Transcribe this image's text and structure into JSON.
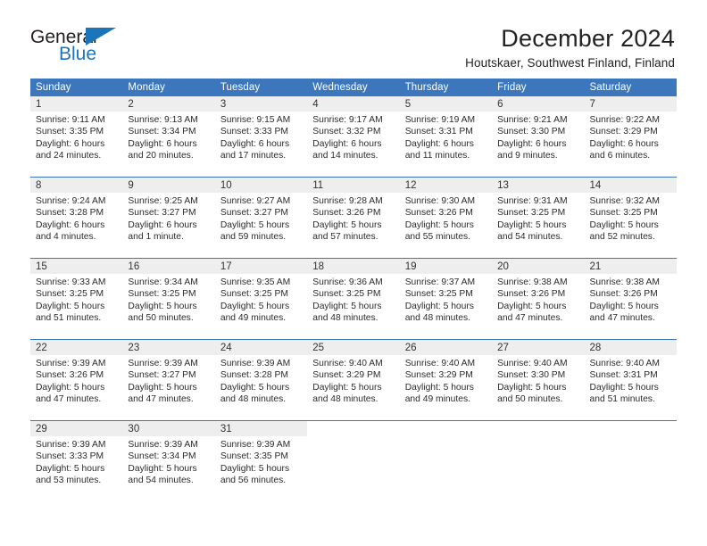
{
  "logo": {
    "word_general": "General",
    "word_blue": "Blue",
    "mark": "triangle-flag",
    "color_blue": "#1b75bb",
    "color_dark": "#231f20"
  },
  "header": {
    "title": "December 2024",
    "subtitle": "Houtskaer, Southwest Finland, Finland"
  },
  "theme": {
    "header_blue": "#3c77bd",
    "daynum_band": "#eeeeee",
    "text": "#2b2b2b"
  },
  "calendar": {
    "weekday_headers": [
      "Sunday",
      "Monday",
      "Tuesday",
      "Wednesday",
      "Thursday",
      "Friday",
      "Saturday"
    ],
    "weeks": [
      [
        {
          "day": "1",
          "sunrise": "Sunrise: 9:11 AM",
          "sunset": "Sunset: 3:35 PM",
          "daylight_line1": "Daylight: 6 hours",
          "daylight_line2": "and 24 minutes."
        },
        {
          "day": "2",
          "sunrise": "Sunrise: 9:13 AM",
          "sunset": "Sunset: 3:34 PM",
          "daylight_line1": "Daylight: 6 hours",
          "daylight_line2": "and 20 minutes."
        },
        {
          "day": "3",
          "sunrise": "Sunrise: 9:15 AM",
          "sunset": "Sunset: 3:33 PM",
          "daylight_line1": "Daylight: 6 hours",
          "daylight_line2": "and 17 minutes."
        },
        {
          "day": "4",
          "sunrise": "Sunrise: 9:17 AM",
          "sunset": "Sunset: 3:32 PM",
          "daylight_line1": "Daylight: 6 hours",
          "daylight_line2": "and 14 minutes."
        },
        {
          "day": "5",
          "sunrise": "Sunrise: 9:19 AM",
          "sunset": "Sunset: 3:31 PM",
          "daylight_line1": "Daylight: 6 hours",
          "daylight_line2": "and 11 minutes."
        },
        {
          "day": "6",
          "sunrise": "Sunrise: 9:21 AM",
          "sunset": "Sunset: 3:30 PM",
          "daylight_line1": "Daylight: 6 hours",
          "daylight_line2": "and 9 minutes."
        },
        {
          "day": "7",
          "sunrise": "Sunrise: 9:22 AM",
          "sunset": "Sunset: 3:29 PM",
          "daylight_line1": "Daylight: 6 hours",
          "daylight_line2": "and 6 minutes."
        }
      ],
      [
        {
          "day": "8",
          "sunrise": "Sunrise: 9:24 AM",
          "sunset": "Sunset: 3:28 PM",
          "daylight_line1": "Daylight: 6 hours",
          "daylight_line2": "and 4 minutes."
        },
        {
          "day": "9",
          "sunrise": "Sunrise: 9:25 AM",
          "sunset": "Sunset: 3:27 PM",
          "daylight_line1": "Daylight: 6 hours",
          "daylight_line2": "and 1 minute."
        },
        {
          "day": "10",
          "sunrise": "Sunrise: 9:27 AM",
          "sunset": "Sunset: 3:27 PM",
          "daylight_line1": "Daylight: 5 hours",
          "daylight_line2": "and 59 minutes."
        },
        {
          "day": "11",
          "sunrise": "Sunrise: 9:28 AM",
          "sunset": "Sunset: 3:26 PM",
          "daylight_line1": "Daylight: 5 hours",
          "daylight_line2": "and 57 minutes."
        },
        {
          "day": "12",
          "sunrise": "Sunrise: 9:30 AM",
          "sunset": "Sunset: 3:26 PM",
          "daylight_line1": "Daylight: 5 hours",
          "daylight_line2": "and 55 minutes."
        },
        {
          "day": "13",
          "sunrise": "Sunrise: 9:31 AM",
          "sunset": "Sunset: 3:25 PM",
          "daylight_line1": "Daylight: 5 hours",
          "daylight_line2": "and 54 minutes."
        },
        {
          "day": "14",
          "sunrise": "Sunrise: 9:32 AM",
          "sunset": "Sunset: 3:25 PM",
          "daylight_line1": "Daylight: 5 hours",
          "daylight_line2": "and 52 minutes."
        }
      ],
      [
        {
          "day": "15",
          "sunrise": "Sunrise: 9:33 AM",
          "sunset": "Sunset: 3:25 PM",
          "daylight_line1": "Daylight: 5 hours",
          "daylight_line2": "and 51 minutes."
        },
        {
          "day": "16",
          "sunrise": "Sunrise: 9:34 AM",
          "sunset": "Sunset: 3:25 PM",
          "daylight_line1": "Daylight: 5 hours",
          "daylight_line2": "and 50 minutes."
        },
        {
          "day": "17",
          "sunrise": "Sunrise: 9:35 AM",
          "sunset": "Sunset: 3:25 PM",
          "daylight_line1": "Daylight: 5 hours",
          "daylight_line2": "and 49 minutes."
        },
        {
          "day": "18",
          "sunrise": "Sunrise: 9:36 AM",
          "sunset": "Sunset: 3:25 PM",
          "daylight_line1": "Daylight: 5 hours",
          "daylight_line2": "and 48 minutes."
        },
        {
          "day": "19",
          "sunrise": "Sunrise: 9:37 AM",
          "sunset": "Sunset: 3:25 PM",
          "daylight_line1": "Daylight: 5 hours",
          "daylight_line2": "and 48 minutes."
        },
        {
          "day": "20",
          "sunrise": "Sunrise: 9:38 AM",
          "sunset": "Sunset: 3:26 PM",
          "daylight_line1": "Daylight: 5 hours",
          "daylight_line2": "and 47 minutes."
        },
        {
          "day": "21",
          "sunrise": "Sunrise: 9:38 AM",
          "sunset": "Sunset: 3:26 PM",
          "daylight_line1": "Daylight: 5 hours",
          "daylight_line2": "and 47 minutes."
        }
      ],
      [
        {
          "day": "22",
          "sunrise": "Sunrise: 9:39 AM",
          "sunset": "Sunset: 3:26 PM",
          "daylight_line1": "Daylight: 5 hours",
          "daylight_line2": "and 47 minutes."
        },
        {
          "day": "23",
          "sunrise": "Sunrise: 9:39 AM",
          "sunset": "Sunset: 3:27 PM",
          "daylight_line1": "Daylight: 5 hours",
          "daylight_line2": "and 47 minutes."
        },
        {
          "day": "24",
          "sunrise": "Sunrise: 9:39 AM",
          "sunset": "Sunset: 3:28 PM",
          "daylight_line1": "Daylight: 5 hours",
          "daylight_line2": "and 48 minutes."
        },
        {
          "day": "25",
          "sunrise": "Sunrise: 9:40 AM",
          "sunset": "Sunset: 3:29 PM",
          "daylight_line1": "Daylight: 5 hours",
          "daylight_line2": "and 48 minutes."
        },
        {
          "day": "26",
          "sunrise": "Sunrise: 9:40 AM",
          "sunset": "Sunset: 3:29 PM",
          "daylight_line1": "Daylight: 5 hours",
          "daylight_line2": "and 49 minutes."
        },
        {
          "day": "27",
          "sunrise": "Sunrise: 9:40 AM",
          "sunset": "Sunset: 3:30 PM",
          "daylight_line1": "Daylight: 5 hours",
          "daylight_line2": "and 50 minutes."
        },
        {
          "day": "28",
          "sunrise": "Sunrise: 9:40 AM",
          "sunset": "Sunset: 3:31 PM",
          "daylight_line1": "Daylight: 5 hours",
          "daylight_line2": "and 51 minutes."
        }
      ],
      [
        {
          "day": "29",
          "sunrise": "Sunrise: 9:39 AM",
          "sunset": "Sunset: 3:33 PM",
          "daylight_line1": "Daylight: 5 hours",
          "daylight_line2": "and 53 minutes."
        },
        {
          "day": "30",
          "sunrise": "Sunrise: 9:39 AM",
          "sunset": "Sunset: 3:34 PM",
          "daylight_line1": "Daylight: 5 hours",
          "daylight_line2": "and 54 minutes."
        },
        {
          "day": "31",
          "sunrise": "Sunrise: 9:39 AM",
          "sunset": "Sunset: 3:35 PM",
          "daylight_line1": "Daylight: 5 hours",
          "daylight_line2": "and 56 minutes."
        },
        {
          "day": "",
          "sunrise": "",
          "sunset": "",
          "daylight_line1": "",
          "daylight_line2": ""
        },
        {
          "day": "",
          "sunrise": "",
          "sunset": "",
          "daylight_line1": "",
          "daylight_line2": ""
        },
        {
          "day": "",
          "sunrise": "",
          "sunset": "",
          "daylight_line1": "",
          "daylight_line2": ""
        },
        {
          "day": "",
          "sunrise": "",
          "sunset": "",
          "daylight_line1": "",
          "daylight_line2": ""
        }
      ]
    ]
  }
}
